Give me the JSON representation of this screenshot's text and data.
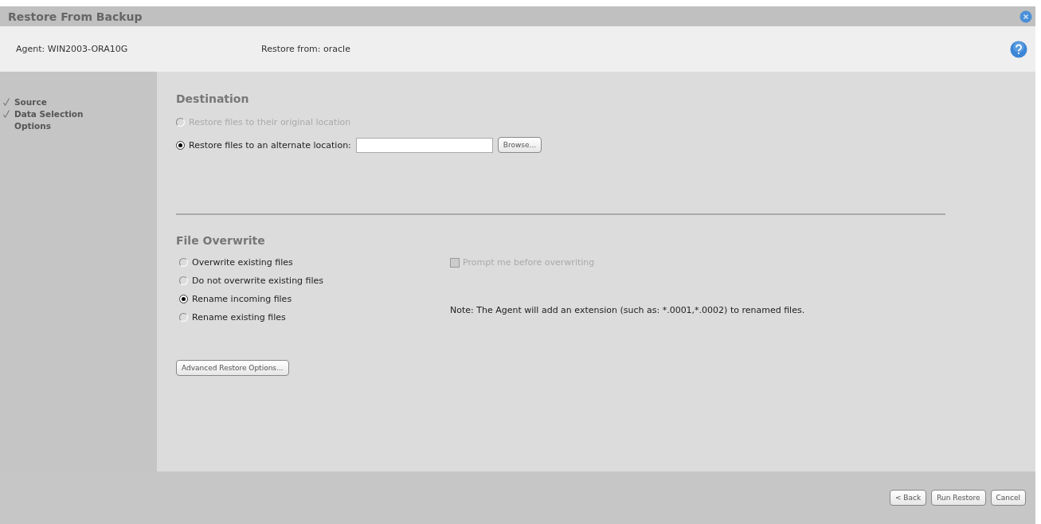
{
  "window": {
    "title": "Restore From Backup"
  },
  "header": {
    "agent": "Agent:  WIN2003-ORA10G",
    "restore_from": "Restore from: oracle"
  },
  "sidebar": {
    "items": [
      {
        "label": "Source",
        "checked": true
      },
      {
        "label": "Data Selection",
        "checked": true
      },
      {
        "label": "Options",
        "checked": false
      }
    ]
  },
  "destination": {
    "heading": "Destination",
    "options": [
      {
        "label": "Restore files to their original location",
        "selected": false,
        "disabled": true,
        "has_path": false
      },
      {
        "label": "Restore files to an alternate location:",
        "selected": true,
        "disabled": false,
        "has_path": true
      }
    ],
    "browse_button": "Browse..."
  },
  "file_overwrite": {
    "heading": "File Overwrite",
    "options": [
      {
        "label": "Overwrite existing files",
        "selected": false
      },
      {
        "label": "Do not overwrite existing files",
        "selected": false
      },
      {
        "label": "Rename incoming files",
        "selected": true
      },
      {
        "label": "Rename existing files",
        "selected": false
      }
    ],
    "prompt": {
      "label": "Prompt me before overwriting",
      "checked": false,
      "disabled": true
    },
    "note": "Note: The Agent will add an extension (such as: *.0001,*.0002) to renamed files.",
    "advanced_button": "Advanced Restore Options..."
  },
  "footer": {
    "buttons": [
      "< Back",
      "Run Restore",
      "Cancel"
    ]
  }
}
